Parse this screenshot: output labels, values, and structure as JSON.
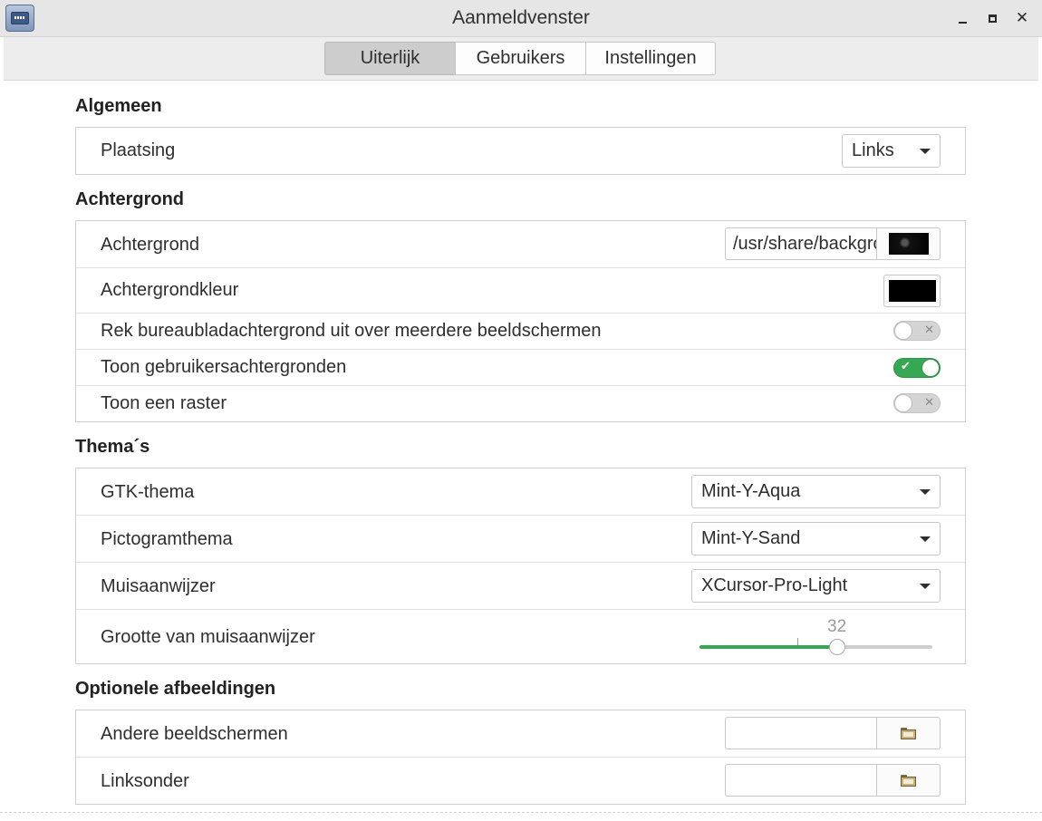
{
  "window": {
    "title": "Aanmeldvenster"
  },
  "tabs": [
    {
      "label": "Uiterlijk",
      "active": true
    },
    {
      "label": "Gebruikers",
      "active": false
    },
    {
      "label": "Instellingen",
      "active": false
    }
  ],
  "sections": {
    "general": {
      "heading": "Algemeen",
      "placement_label": "Plaatsing",
      "placement_value": "Links"
    },
    "background": {
      "heading": "Achtergrond",
      "background_label": "Achtergrond",
      "background_path": "/usr/share/backgrounds",
      "background_color_label": "Achtergrondkleur",
      "background_color": "#000000",
      "stretch_label": "Rek bureaubladachtergrond uit over meerdere beeldschermen",
      "stretch_on": false,
      "user_bg_label": "Toon gebruikersachtergronden",
      "user_bg_on": true,
      "grid_label": "Toon een raster",
      "grid_on": false
    },
    "themes": {
      "heading": "Thema´s",
      "gtk_label": "GTK-thema",
      "gtk_value": "Mint-Y-Aqua",
      "icon_label": "Pictogramthema",
      "icon_value": "Mint-Y-Sand",
      "cursor_label": "Muisaanwijzer",
      "cursor_value": "XCursor-Pro-Light",
      "cursor_size_label": "Grootte van muisaanwijzer",
      "cursor_size_value": "32",
      "cursor_size_fraction": 0.59
    },
    "optional": {
      "heading": "Optionele afbeeldingen",
      "other_monitors_label": "Andere beeldschermen",
      "other_monitors_value": "",
      "bottom_left_label": "Linksonder",
      "bottom_left_value": ""
    }
  },
  "colors": {
    "accent_green": "#35a854",
    "titlebar": "#e6e6e6",
    "toolbar": "#ededed"
  },
  "icons": {
    "app": "login-window-icon",
    "picker": "folder-icon",
    "combo": "chevron-down-icon"
  }
}
